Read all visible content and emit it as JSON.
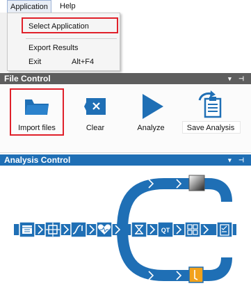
{
  "menubar": {
    "application": "Application",
    "help": "Help"
  },
  "dropdown": {
    "select_application": "Select Application",
    "export_results": "Export Results",
    "exit": "Exit",
    "exit_shortcut": "Alt+F4"
  },
  "file_control": {
    "title": "File Control",
    "tools": [
      {
        "label": "Import files",
        "icon": "folder-icon"
      },
      {
        "label": "Clear",
        "icon": "clear-icon"
      },
      {
        "label": "Analyze",
        "icon": "play-icon"
      },
      {
        "label": "Save Analysis",
        "icon": "save-analysis-icon"
      }
    ]
  },
  "analysis_control": {
    "title": "Analysis Control"
  },
  "colors": {
    "accent_blue": "#1f6fb5",
    "highlight_red": "#e0202a",
    "node_orange": "#f2a21b"
  }
}
